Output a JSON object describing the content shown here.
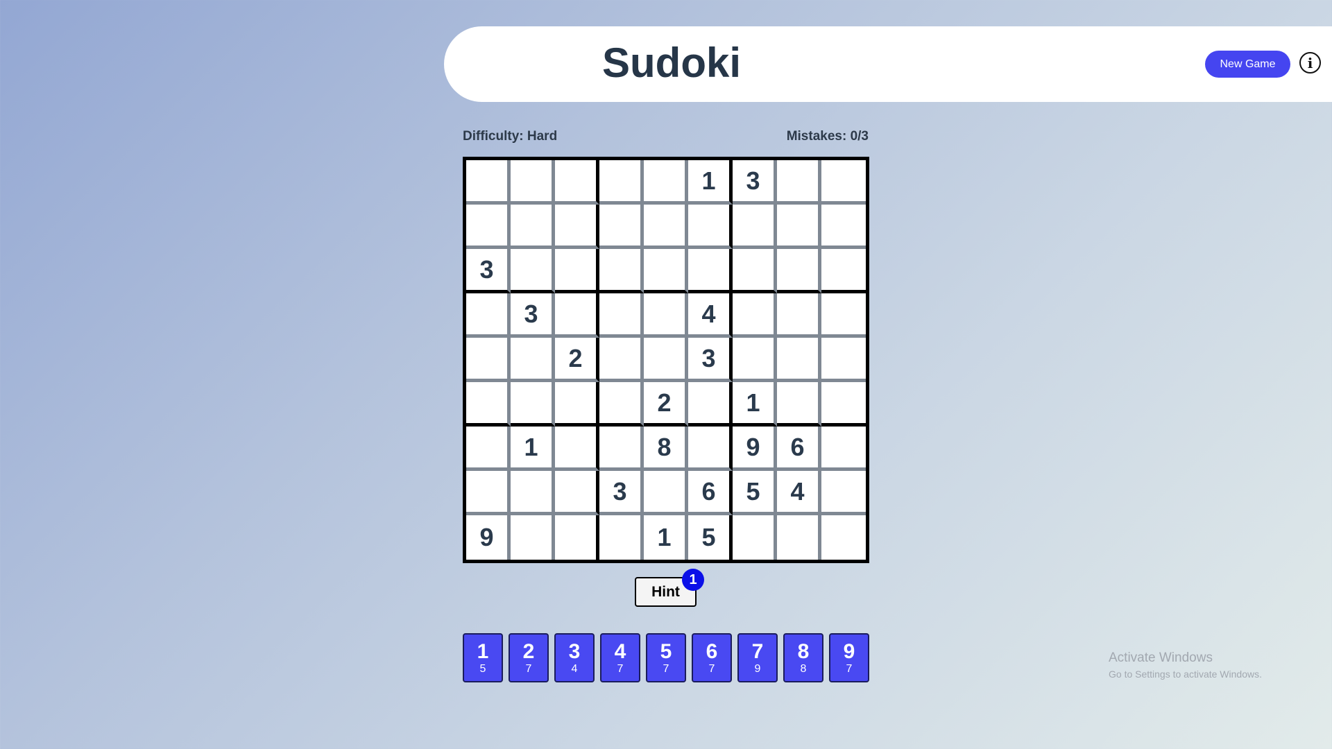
{
  "header": {
    "title": "Sudoki",
    "new_game_label": "New Game",
    "info_icon": "info-icon",
    "info_glyph": "i"
  },
  "status": {
    "difficulty": "Difficulty: Hard",
    "mistakes": "Mistakes: 0/3"
  },
  "board": {
    "cells": [
      [
        "",
        "",
        "",
        "",
        "",
        "1",
        "3",
        "",
        ""
      ],
      [
        "",
        "",
        "",
        "",
        "",
        "",
        "",
        "",
        ""
      ],
      [
        "3",
        "",
        "",
        "",
        "",
        "",
        "",
        "",
        ""
      ],
      [
        "",
        "3",
        "",
        "",
        "",
        "4",
        "",
        "",
        ""
      ],
      [
        "",
        "",
        "2",
        "",
        "",
        "3",
        "",
        "",
        ""
      ],
      [
        "",
        "",
        "",
        "",
        "2",
        "",
        "1",
        "",
        ""
      ],
      [
        "",
        "1",
        "",
        "",
        "8",
        "",
        "9",
        "6",
        ""
      ],
      [
        "",
        "",
        "",
        "3",
        "",
        "6",
        "5",
        "4",
        ""
      ],
      [
        "9",
        "",
        "",
        "",
        "1",
        "5",
        "",
        "",
        ""
      ]
    ]
  },
  "hint": {
    "label": "Hint",
    "remaining": "1"
  },
  "numpad": [
    {
      "digit": "1",
      "count": "5"
    },
    {
      "digit": "2",
      "count": "7"
    },
    {
      "digit": "3",
      "count": "4"
    },
    {
      "digit": "4",
      "count": "7"
    },
    {
      "digit": "5",
      "count": "7"
    },
    {
      "digit": "6",
      "count": "7"
    },
    {
      "digit": "7",
      "count": "9"
    },
    {
      "digit": "8",
      "count": "8"
    },
    {
      "digit": "9",
      "count": "7"
    }
  ],
  "watermark": {
    "title": "Activate Windows",
    "subtitle": "Go to Settings to activate Windows."
  },
  "colors": {
    "accent": "#4545f0",
    "numpad": "#4949f2",
    "badge": "#0b10e8",
    "title": "#263648"
  }
}
